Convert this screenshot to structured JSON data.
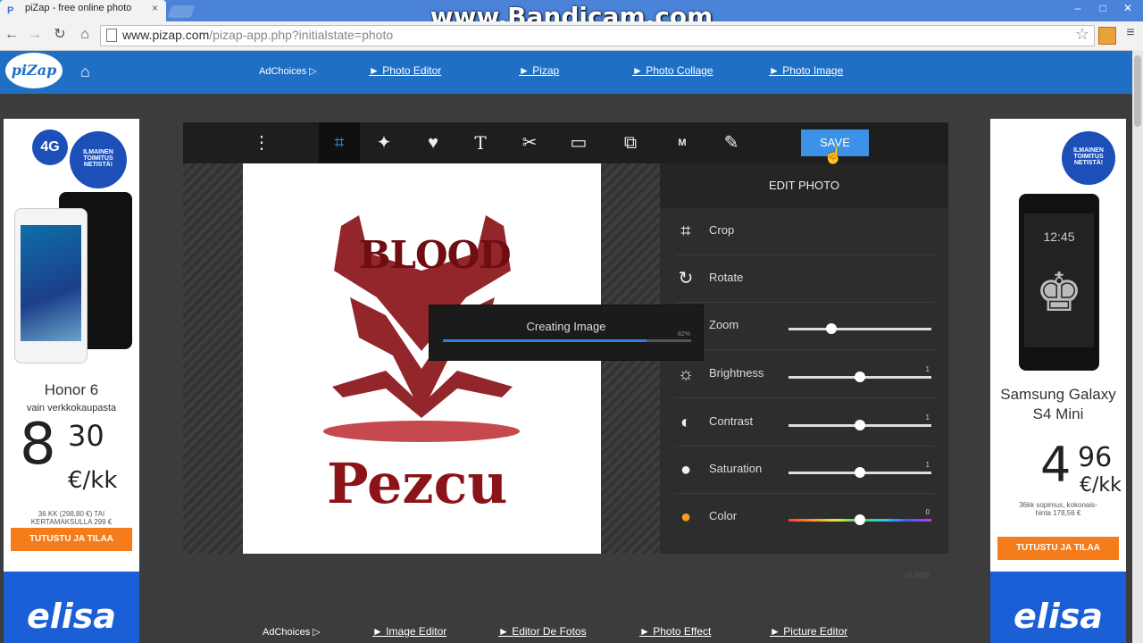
{
  "watermark": "www.Bandicam.com",
  "browser": {
    "tab_title": "piZap - free online photo",
    "tab_close": "×",
    "url_host": "www.pizap.com",
    "url_path": "/pizap-app.php?initialstate=photo"
  },
  "site": {
    "logo_text": "piZap",
    "top_nav": {
      "adchoices": "AdChoices ▷",
      "links": [
        "► Photo Editor",
        "► Pizap",
        "► Photo Collage",
        "► Photo Image"
      ]
    },
    "bottom_nav": {
      "adchoices": "AdChoices ▷",
      "links": [
        "► Image Editor",
        "► Editor De Fotos",
        "► Photo Effect",
        "► Picture Editor"
      ]
    }
  },
  "ad_left": {
    "badge_top": "4G",
    "badge_text": "ILMAINEN TOIMITUS NETISTÄ!",
    "product": "Honor 6",
    "subtitle": "vain verkkokaupasta",
    "price_major": "8",
    "price_minor": "30",
    "price_unit": "€/kk",
    "fine_print": "36 KK (298,80 €) TAI KERTAMAKSULLA 299 €",
    "cta": "TUTUSTU JA TILAA",
    "brand": "elisa"
  },
  "ad_right": {
    "badge_text": "ILMAINEN TOIMITUS NETISTÄ!",
    "product": "Samsung Galaxy S4 Mini",
    "phone_time": "12:45",
    "price_major": "4",
    "price_minor": "96",
    "price_unit": "€/kk",
    "fine_print": "36kk sopimus, kokonais-hinta 178,56 €",
    "cta": "TUTUSTU JA TILAA",
    "brand": "elisa"
  },
  "editor": {
    "save_label": "SAVE",
    "panel_title": "EDIT PHOTO",
    "tools": [
      {
        "label": "Crop"
      },
      {
        "label": "Rotate"
      },
      {
        "label": "Zoom",
        "level": 0.3
      },
      {
        "label": "Brightness",
        "value": "1",
        "level": 0.5
      },
      {
        "label": "Contrast",
        "value": "1",
        "level": 0.5
      },
      {
        "label": "Saturation",
        "value": "1",
        "level": 0.5
      },
      {
        "label": "Color",
        "value": "0",
        "level": 0.5
      }
    ],
    "image_text_top": "BLOOD",
    "image_text_bottom": "Pezcu",
    "dialog": {
      "title": "Creating Image",
      "progress": 0.82,
      "percent": "82%"
    },
    "version": "v2.0005"
  }
}
